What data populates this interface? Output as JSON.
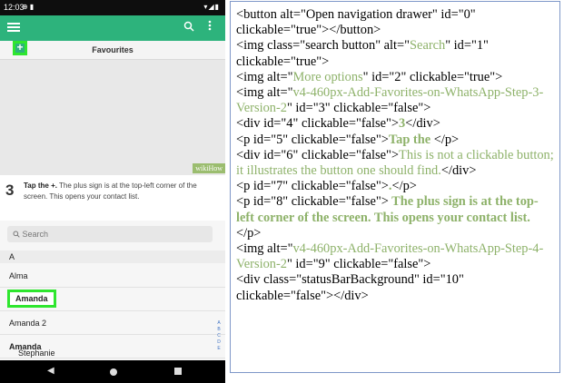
{
  "phone": {
    "status": {
      "time": "12:03",
      "left_icons": "⊕ ▮",
      "right_icons": "▾◢▮"
    },
    "app_bar": {
      "search_icon": "search-icon",
      "more_icon": "more-vert-icon",
      "menu_icon": "menu-icon"
    },
    "image1": {
      "title": "Favourites",
      "plus": "+",
      "badge": "wikiHow"
    },
    "step": {
      "number": "3",
      "bold": "Tap the +.",
      "text": " The plus sign is at the top-left corner of the screen. This opens your contact list."
    },
    "image2": {
      "search_placeholder": "Search",
      "section": "A",
      "contacts": [
        "Alma",
        "Amanda",
        "Amanda 2"
      ],
      "stephanie_prefix": "Stephanie ",
      "stephanie_bold": "Amanda",
      "index": [
        "A",
        "B",
        "C",
        "D",
        "E"
      ]
    },
    "nav": {
      "back": "◀"
    },
    "colors": {
      "app_bar": "#2db37c",
      "highlight": "#2ee62e",
      "tree_green": "#8eb26a"
    }
  },
  "tree": {
    "l0_a": "<button alt=\"Open navigation drawer\" id=\"0\"",
    "l0_b": "clickable=\"true\"></button>",
    "l1_a": "<img class=\"search button\" alt=\"",
    "l1_g": "Search",
    "l1_b": "\" id=\"1\"",
    "l1_c": "clickable=\"true\">",
    "l2_a": "<img alt=\"",
    "l2_g": "More options",
    "l2_b": "\" id=\"2\" clickable=\"true\">",
    "l3_a": "<img alt=\"",
    "l3_g": "v4-460px-Add-Favorites-on-WhatsApp-Step-3-Version-2",
    "l3_b": "\" id=\"3\" clickable=\"false\">",
    "l4_a": "<div id=\"4\" clickable=\"false\">",
    "l4_g": "3",
    "l4_b": "</div>",
    "l5_a": "<p id=\"5\" clickable=\"false\">",
    "l5_g": "Tap the",
    "l5_b": " </p>",
    "l6_a": "<div id=\"6\" clickable=\"false\">",
    "l6_g": "This is not a clickable button; it illustrates the button one should find.",
    "l6_b": "</div>",
    "l7_a": "<p id=\"7\" clickable=\"false\">",
    "l7_g": ".",
    "l7_b": "</p>",
    "l8_a": "<p id=\"8\" clickable=\"false\">",
    "l8_g": " The plus sign is at the top-left corner of the screen. This opens your contact list.",
    "l8_b": "</p>",
    "l9_a": "<img alt=\"",
    "l9_g": "v4-460px-Add-Favorites-on-WhatsApp-Step-4-Version-2",
    "l9_b": "\" id=\"9\" clickable=\"false\">",
    "l10_a": "<div class=\"statusBarBackground\" id=\"10\"",
    "l10_b": "clickable=\"false\"></div>"
  }
}
